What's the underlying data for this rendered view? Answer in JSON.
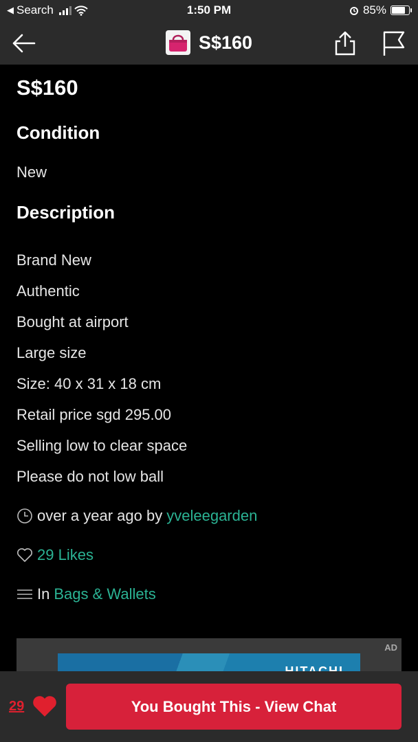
{
  "status_bar": {
    "back_app": "Search",
    "time": "1:50 PM",
    "battery": "85%",
    "battery_level": 0.85
  },
  "nav": {
    "title": "S$160",
    "icons": [
      "back-arrow-icon",
      "share-icon",
      "flag-icon"
    ]
  },
  "listing": {
    "price": "S$160",
    "condition_heading": "Condition",
    "condition_value": "New",
    "description_heading": "Description",
    "description_lines": [
      "Brand New",
      "Authentic",
      "Bought at airport",
      "Large size",
      "Size: 40 x 31 x 18 cm",
      "Retail price sgd 295.00",
      "Selling low to clear space",
      "Please do not low ball"
    ],
    "posted": {
      "prefix": "over a year ago by",
      "seller": "yveleegarden"
    },
    "likes": "29 Likes",
    "category": {
      "prefix": "In",
      "name": "Bags & Wallets"
    }
  },
  "ad": {
    "label": "AD",
    "brand": "HITACHI"
  },
  "bottom_bar": {
    "likes_count": "29",
    "cta": "You Bought This - View Chat"
  },
  "colors": {
    "accent_green": "#2bb394",
    "brand_red": "#d7213a",
    "bar_bg": "#2b2b2b"
  }
}
